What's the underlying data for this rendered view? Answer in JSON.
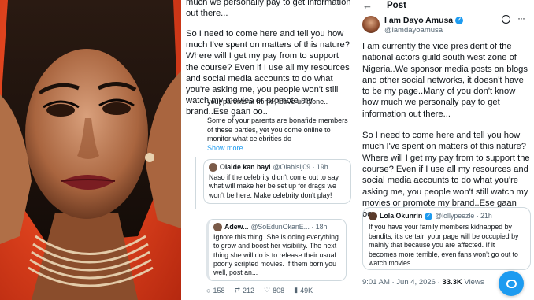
{
  "middle": {
    "paragraph_1": "much we personally pay to get information out there...",
    "paragraph_2": "So I need to come here and tell you how much I've spent on matters of this nature? Where will I get my pay from to support the course? Even if I use all my resources and social media accounts to do what you're asking me, you people won't still watch my movies or promote my brand..Ese gaan oo..",
    "reply_1": "your parents at home, leave us alone..",
    "reply_2": "Some of your parents are bonafide members of these parties, yet you come online to monitor what celebrities do",
    "show_more": "Show more",
    "quote_1": {
      "name": "Olaide kan bayi",
      "handle": "@Olabisij09 · 19h",
      "text": "Naso if the celebrity didn't come out to say what will make her be set up for drags we won't be here. Make celebrity don't play!"
    },
    "quote_2": {
      "name": "Adew...",
      "handle": "@SoEdunOkanE... · 18h",
      "text": "Ignore this thing. She is doing everything to grow and boost her visibility. The next thing she will do is to release their usual poorly scripted movies. If them born you well, post an..."
    },
    "engagement": {
      "replies": "158",
      "reposts": "212",
      "likes": "808",
      "views": "49K"
    }
  },
  "post": {
    "back": "←",
    "title": "Post",
    "author_name": "I am Dayo Amusa",
    "author_handle": "@iamdayoamusa",
    "more": "···",
    "paragraph_1": "I am currently the vice president of the national actors guild south west zone of Nigeria..We sponsor media posts on blogs and other social networks, it doesn't have to be my page..Many of you don't know how much we personally pay to get information out there...",
    "paragraph_2": "So I need to come here and tell you how much I've spent on matters of this nature? Where will I get my pay from to support the course? Even if I use all my resources and social media accounts to do what you're asking me, you people won't still watch my movies or promote my brand..Ese gaan oo..",
    "quote": {
      "name": "Lola Okunrin",
      "handle": "@lollypeezle · 21h",
      "text": "If you have your family members kidnapped by bandits, it's certain your page will be occupied by mainly that because you are affected. If it becomes more terrible, even fans won't go out to watch movies....."
    },
    "time": "9:01 AM · Jun 4, 2026 · ",
    "views_count": "33.3K",
    "views_label": " Views"
  },
  "colors": {
    "accent": "#1d9bf0",
    "photo_background": "#e2451f"
  }
}
